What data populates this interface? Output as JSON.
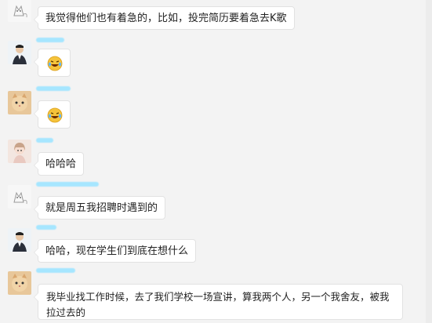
{
  "messages": [
    {
      "sender": "user-a",
      "avatar": "cat-sketch-avatar",
      "type": "text",
      "text": "我觉得他们也有着急的，比如，投完简历要着急去K歌"
    },
    {
      "sender": "user-b",
      "avatar": "man-suit-avatar",
      "type": "emoji",
      "emoji": "laughing-tears-emoji"
    },
    {
      "sender": "user-c",
      "avatar": "cat-photo-avatar",
      "type": "emoji",
      "emoji": "laughing-tears-emoji"
    },
    {
      "sender": "user-d",
      "avatar": "cartoon-girl-avatar",
      "type": "text",
      "text": "哈哈哈"
    },
    {
      "sender": "user-a",
      "avatar": "cat-sketch-avatar",
      "type": "text",
      "text": "就是周五我招聘时遇到的"
    },
    {
      "sender": "user-b",
      "avatar": "man-suit-avatar",
      "type": "text",
      "text": "哈哈，现在学生们到底在想什么"
    },
    {
      "sender": "user-c",
      "avatar": "cat-photo-avatar",
      "type": "text",
      "text": "我毕业找工作时候，去了我们学校一场宣讲，算我两个人，另一个我舍友，被我拉过去的"
    }
  ],
  "colors": {
    "background": "#f3f3f3",
    "bubble": "#ffffff",
    "name_redaction": "#a6e6ff"
  }
}
